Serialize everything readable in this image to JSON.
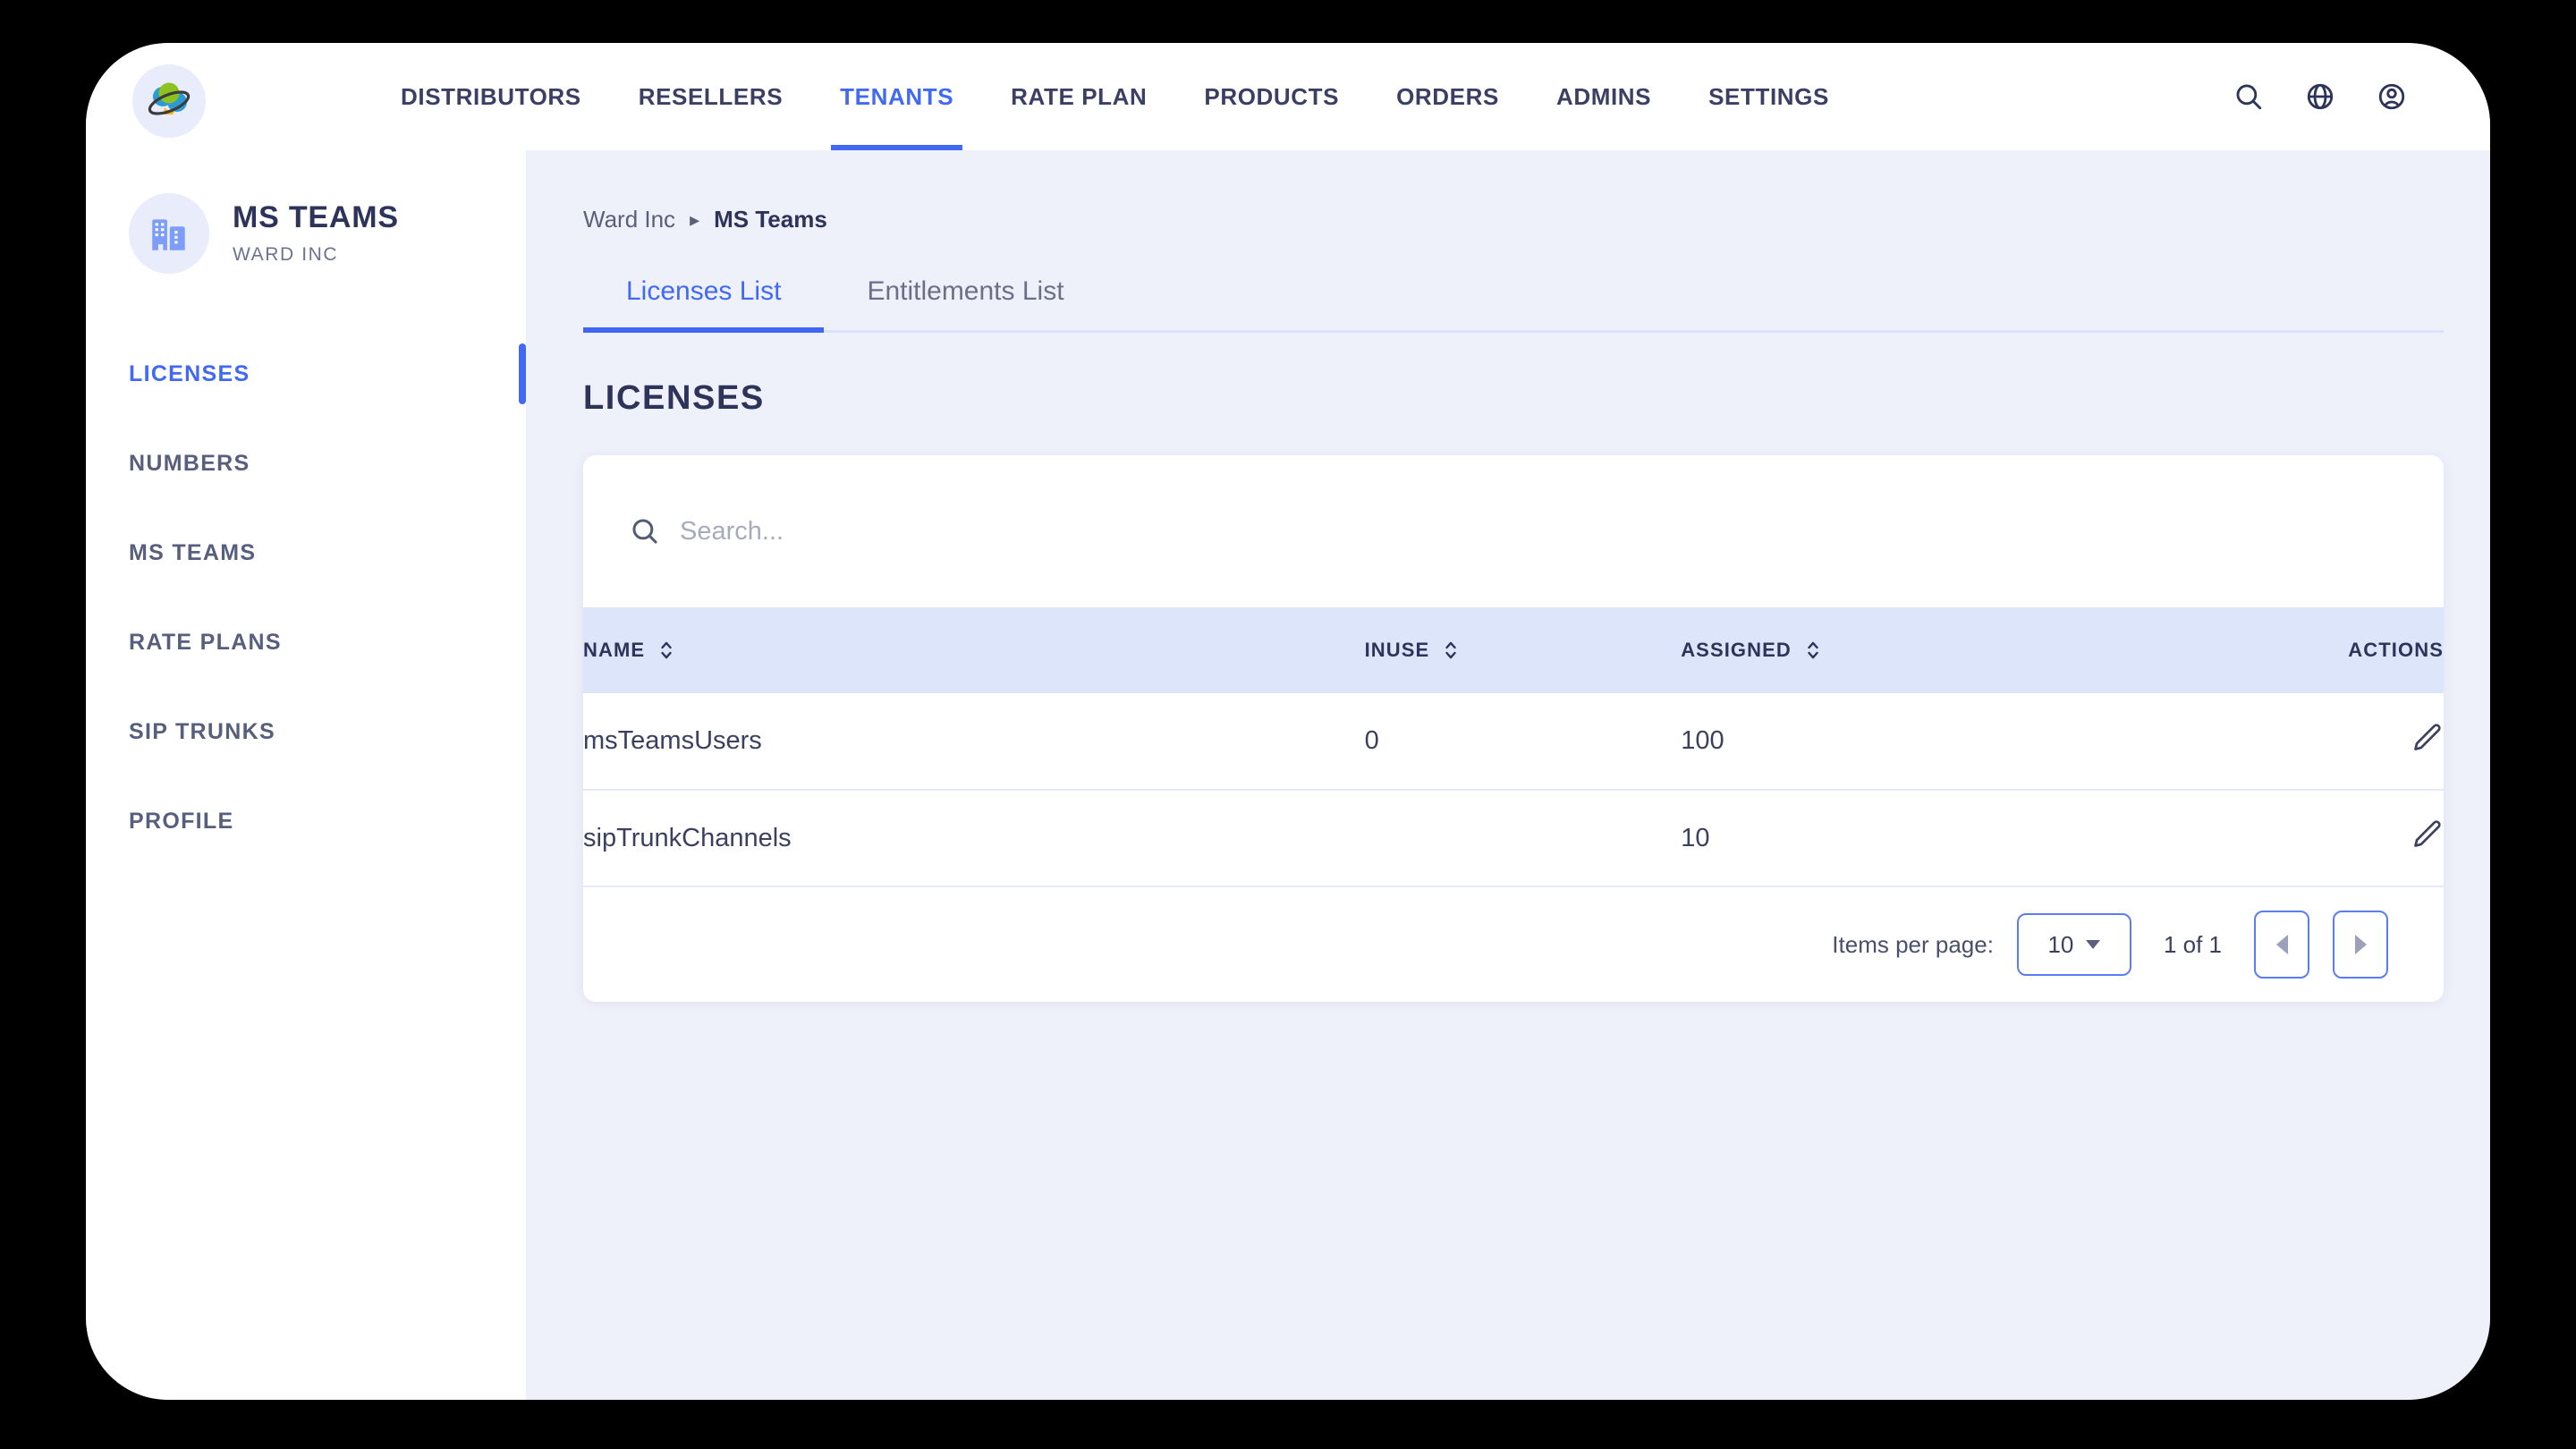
{
  "topnav": {
    "logo_icon": "atom-orbit-logo-icon",
    "links": [
      {
        "label": "DISTRIBUTORS",
        "active": false
      },
      {
        "label": "RESELLERS",
        "active": false
      },
      {
        "label": "TENANTS",
        "active": true
      },
      {
        "label": "RATE PLAN",
        "active": false
      },
      {
        "label": "PRODUCTS",
        "active": false
      },
      {
        "label": "ORDERS",
        "active": false
      },
      {
        "label": "ADMINS",
        "active": false
      },
      {
        "label": "SETTINGS",
        "active": false
      }
    ],
    "icons": [
      "search-icon",
      "globe-icon",
      "account-circle-icon"
    ]
  },
  "sidebar": {
    "avatar_icon": "building-office-icon",
    "title": "MS TEAMS",
    "subtitle": "WARD INC",
    "items": [
      {
        "label": "LICENSES",
        "active": true
      },
      {
        "label": "NUMBERS",
        "active": false
      },
      {
        "label": "MS TEAMS",
        "active": false
      },
      {
        "label": "RATE PLANS",
        "active": false
      },
      {
        "label": "SIP TRUNKS",
        "active": false
      },
      {
        "label": "PROFILE",
        "active": false
      }
    ]
  },
  "breadcrumb": {
    "parent": "Ward Inc",
    "separator": "▸",
    "current": "MS Teams"
  },
  "tabs": [
    {
      "label": "Licenses List",
      "active": true
    },
    {
      "label": "Entitlements List",
      "active": false
    }
  ],
  "page_title": "LICENSES",
  "search": {
    "icon": "search-icon",
    "placeholder": "Search...",
    "value": ""
  },
  "table": {
    "columns": [
      {
        "label": "NAME",
        "sortable": true
      },
      {
        "label": "INUSE",
        "sortable": true
      },
      {
        "label": "ASSIGNED",
        "sortable": true
      },
      {
        "label": "ACTIONS",
        "sortable": false
      }
    ],
    "rows": [
      {
        "name": "msTeamsUsers",
        "inuse": "0",
        "assigned": "100",
        "action_icon": "edit-pencil-icon"
      },
      {
        "name": "sipTrunkChannels",
        "inuse": "",
        "assigned": "10",
        "action_icon": "edit-pencil-icon"
      }
    ]
  },
  "pagination": {
    "items_per_page_label": "Items per page:",
    "items_per_page_value": "10",
    "range_label": "1 of 1",
    "prev_icon": "chevron-left-icon",
    "next_icon": "chevron-right-icon"
  },
  "colors": {
    "accent": "#4169f2",
    "nav_text": "#3b3f63",
    "page_bg": "#eef0fa",
    "table_header_bg": "#dde5fb",
    "heading": "#2d3359"
  }
}
